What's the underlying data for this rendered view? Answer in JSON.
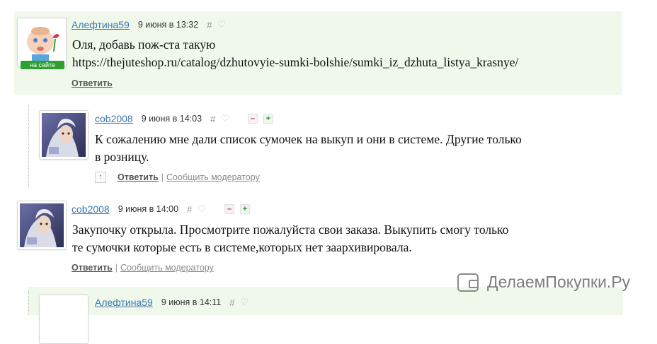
{
  "comments": [
    {
      "author": "Алефтина59",
      "date": "9 июня в 13:32",
      "hash": "#",
      "online_badge": "на сайте",
      "text_line1": "Оля, добавь пож-ста такую",
      "text_line2": "https://thejuteshop.ru/catalog/dzhutovyie-sumki-bolshie/sumki_iz_dzhuta_listya_krasnye/",
      "reply": "Ответить"
    },
    {
      "author": "cob2008",
      "date": "9 июня в 14:03",
      "hash": "#",
      "vote_minus": "–",
      "vote_plus": "+",
      "text_line1": "К сожалению мне дали список сумочек на выкуп и они в системе. Другие только",
      "text_line2": "в розницу.",
      "up": "↑",
      "reply": "Ответить",
      "separator": "|",
      "report": "Сообщить модератору"
    },
    {
      "author": "cob2008",
      "date": "9 июня в 14:00",
      "hash": "#",
      "vote_minus": "–",
      "vote_plus": "+",
      "text_line1": "Закупочку открыла. Просмотрите пожалуйста свои заказа. Выкупить смогу только",
      "text_line2": "те сумочки которые есть в системе,которых нет заархивировала.",
      "reply": "Ответить",
      "separator": "|",
      "report": "Сообщить модератору"
    },
    {
      "author": "Алефтина59",
      "date": "9 июня в 14:11",
      "hash": "#"
    }
  ],
  "watermark": "ДелаемПокупки.Ру",
  "colors": {
    "highlight_bg": "#eff8ea",
    "link": "#3a78b3",
    "online": "#2ea02e"
  }
}
